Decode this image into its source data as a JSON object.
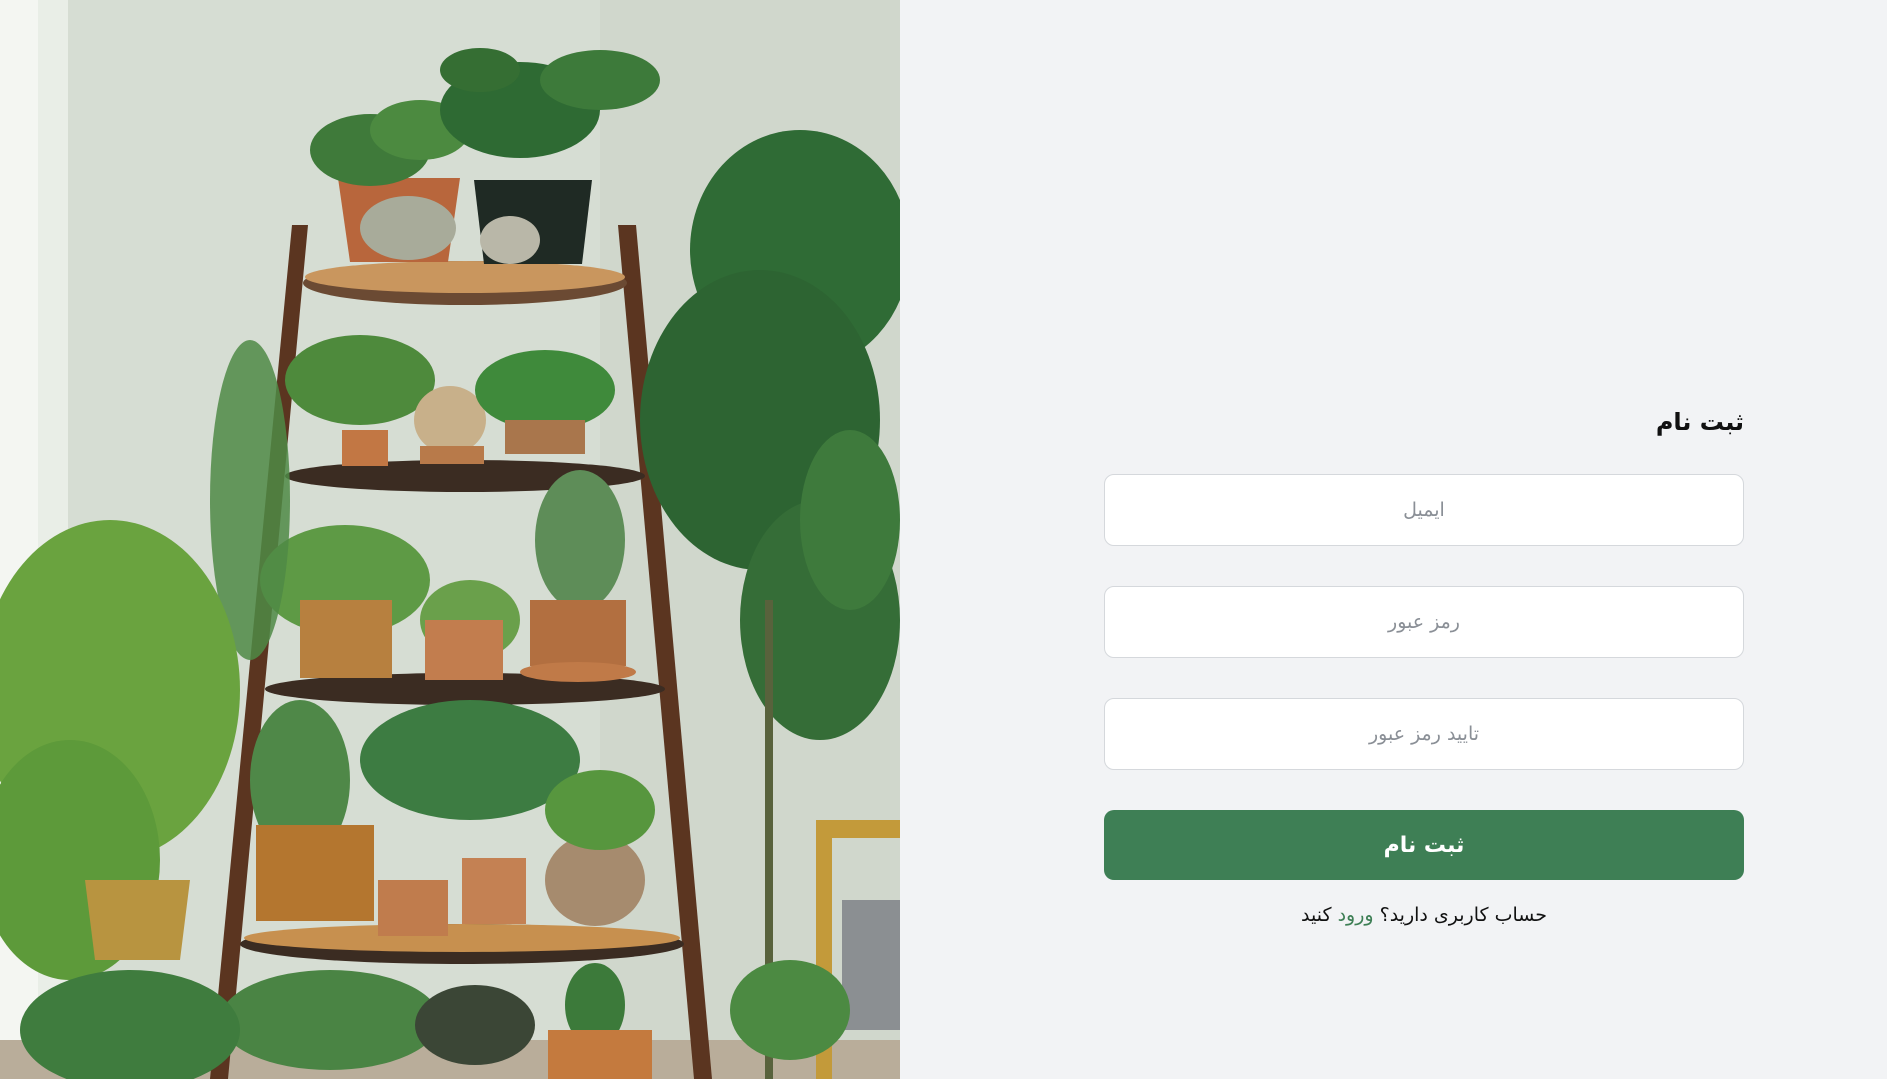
{
  "hero_image": {
    "alt": "plants-on-ladder-shelf"
  },
  "form": {
    "title": "ثبت نام",
    "email_placeholder": "ایمیل",
    "password_placeholder": "رمز عبور",
    "confirm_password_placeholder": "تایید رمز عبور",
    "submit_label": "ثبت نام",
    "has_account_text": "حساب کاربری دارید؟",
    "login_link_label": "ورود",
    "login_suffix": "کنید"
  },
  "colors": {
    "accent": "#3e7f55",
    "background": "#f2f3f5",
    "input_border": "#d5d8dc"
  }
}
